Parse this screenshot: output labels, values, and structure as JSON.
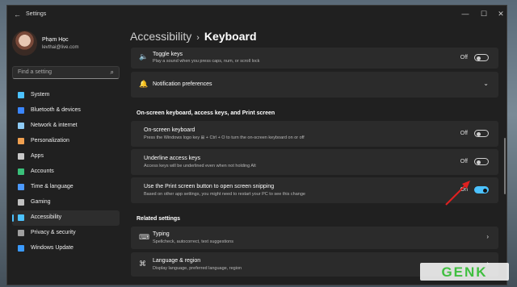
{
  "window": {
    "title": "Settings",
    "back_glyph": "←",
    "controls": {
      "minimize": "—",
      "maximize": "☐",
      "close": "✕"
    }
  },
  "profile": {
    "name": "Phạm Học",
    "email": "levthai@live.com"
  },
  "search": {
    "placeholder": "Find a setting",
    "icon": "search-icon"
  },
  "nav": [
    {
      "label": "System",
      "icon": "monitor-icon",
      "color": "#4cc2ff"
    },
    {
      "label": "Bluetooth & devices",
      "icon": "bluetooth-icon",
      "color": "#3a86ff"
    },
    {
      "label": "Network & internet",
      "icon": "wifi-icon",
      "color": "#8ecbf5"
    },
    {
      "label": "Personalization",
      "icon": "brush-icon",
      "color": "#f0a050"
    },
    {
      "label": "Apps",
      "icon": "apps-icon",
      "color": "#c8c8c8"
    },
    {
      "label": "Accounts",
      "icon": "person-icon",
      "color": "#3ac07a"
    },
    {
      "label": "Time & language",
      "icon": "globe-clock-icon",
      "color": "#4c9aff"
    },
    {
      "label": "Gaming",
      "icon": "controller-icon",
      "color": "#c0c0c0"
    },
    {
      "label": "Accessibility",
      "icon": "accessibility-icon",
      "color": "#4cc2ff",
      "active": true
    },
    {
      "label": "Privacy & security",
      "icon": "shield-icon",
      "color": "#a0a0a0"
    },
    {
      "label": "Windows Update",
      "icon": "update-icon",
      "color": "#3a9aff"
    }
  ],
  "breadcrumb": {
    "parent": "Accessibility",
    "separator": "›",
    "current": "Keyboard"
  },
  "cards": {
    "toggle_keys": {
      "title": "Toggle keys",
      "desc": "Play a sound when you press caps, num, or scroll lock",
      "state": "Off",
      "icon": "speaker-icon"
    },
    "notifications": {
      "title": "Notification preferences",
      "icon": "bell-icon"
    },
    "osk": {
      "title": "On-screen keyboard",
      "desc": "Press the Windows logo key ⊞ + Ctrl + O to turn the on-screen keyboard on or off",
      "state": "Off"
    },
    "underline": {
      "title": "Underline access keys",
      "desc": "Access keys will be underlined even when not holding Alt",
      "state": "Off"
    },
    "print_screen": {
      "title": "Use the Print screen button to open screen snipping",
      "desc": "Based on other app settings, you might need to restart your PC to see this change",
      "state": "On"
    },
    "typing": {
      "title": "Typing",
      "desc": "Spellcheck, autocorrect, text suggestions",
      "icon": "keyboard-icon"
    },
    "language": {
      "title": "Language & region",
      "desc": "Display language, preferred language, region",
      "icon": "language-icon"
    }
  },
  "sections": {
    "osk_header": "On-screen keyboard, access keys, and Print screen",
    "related": "Related settings"
  },
  "glyphs": {
    "chevron_down": "⌄",
    "chevron_right": "›"
  },
  "watermark": {
    "text": "GENK",
    "color": "#3fbf3f"
  },
  "annotation": {
    "arrow_color": "#e02020"
  }
}
